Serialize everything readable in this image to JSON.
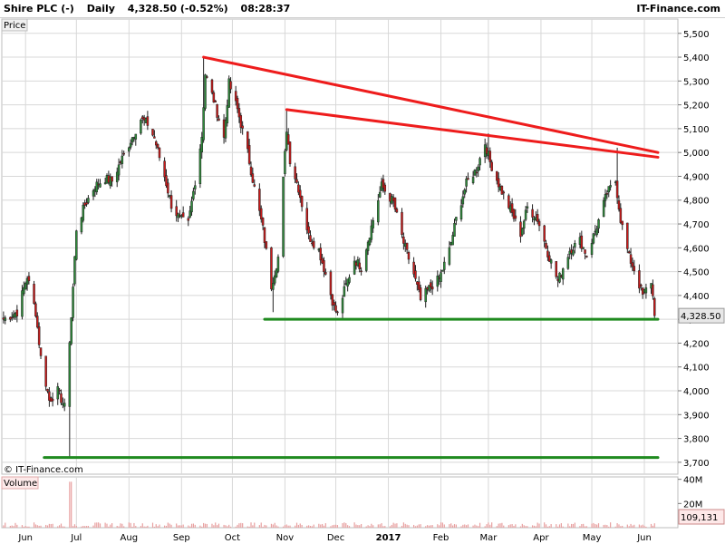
{
  "header": {
    "instrument": "Shire PLC (-)",
    "interval": "Daily",
    "quote": "4,328.50 (-0.52%)",
    "time": "08:28:37",
    "brand": "IT-Finance.com"
  },
  "colors": {
    "up": "#2e8b3a",
    "down": "#cc1a1a",
    "resistance": "#ee1c1c",
    "support": "#1f8a1f",
    "grid": "#d8d8d8",
    "volume": "#e8a0a0",
    "last_box": "#e7e7e7"
  },
  "chart_data": [
    {
      "type": "candlestick",
      "panel_label": "Price",
      "watermark": "© IT-Finance.com",
      "last_price_label": "4,328.50",
      "y_ticks": [
        3700,
        3800,
        3900,
        4000,
        4100,
        4200,
        4300,
        4400,
        4500,
        4600,
        4700,
        4800,
        4900,
        5000,
        5100,
        5200,
        5300,
        5400,
        5500
      ],
      "y_tick_labels": [
        "3,700",
        "3,800",
        "3,900",
        "4,000",
        "4,100",
        "4,200",
        "4,300",
        "4,400",
        "4,500",
        "4,600",
        "4,700",
        "4,800",
        "4,900",
        "5,000",
        "5,100",
        "5,200",
        "5,300",
        "5,400",
        "5,500"
      ],
      "x_labels": [
        {
          "date": "2016-06-01",
          "text": "Jun",
          "bold": false
        },
        {
          "date": "2016-07-01",
          "text": "Jul",
          "bold": false
        },
        {
          "date": "2016-08-01",
          "text": "Aug",
          "bold": false
        },
        {
          "date": "2016-09-01",
          "text": "Sep",
          "bold": false
        },
        {
          "date": "2016-10-01",
          "text": "Oct",
          "bold": false
        },
        {
          "date": "2016-11-01",
          "text": "Nov",
          "bold": false
        },
        {
          "date": "2016-12-01",
          "text": "Dec",
          "bold": false
        },
        {
          "date": "2017-01-01",
          "text": "2017",
          "bold": true
        },
        {
          "date": "2017-02-01",
          "text": "Feb",
          "bold": false
        },
        {
          "date": "2017-03-01",
          "text": "Mar",
          "bold": false
        },
        {
          "date": "2017-04-01",
          "text": "Apr",
          "bold": false
        },
        {
          "date": "2017-05-01",
          "text": "May",
          "bold": false
        },
        {
          "date": "2017-06-01",
          "text": "Jun",
          "bold": false
        }
      ],
      "close_path": [
        [
          "2016-05-19",
          4300
        ],
        [
          "2016-05-27",
          4330
        ],
        [
          "2016-06-02",
          4480
        ],
        [
          "2016-06-07",
          4330
        ],
        [
          "2016-06-10",
          4140
        ],
        [
          "2016-06-15",
          3960
        ],
        [
          "2016-06-20",
          4000
        ],
        [
          "2016-06-24",
          3930
        ],
        [
          "2016-06-28",
          4310
        ],
        [
          "2016-07-01",
          4680
        ],
        [
          "2016-07-06",
          4780
        ],
        [
          "2016-07-12",
          4860
        ],
        [
          "2016-07-18",
          4890
        ],
        [
          "2016-07-22",
          4880
        ],
        [
          "2016-07-27",
          4960
        ],
        [
          "2016-08-02",
          5050
        ],
        [
          "2016-08-08",
          5140
        ],
        [
          "2016-08-12",
          5120
        ],
        [
          "2016-08-16",
          5060
        ],
        [
          "2016-08-22",
          4900
        ],
        [
          "2016-08-26",
          4780
        ],
        [
          "2016-08-31",
          4720
        ],
        [
          "2016-09-05",
          4700
        ],
        [
          "2016-09-09",
          4880
        ],
        [
          "2016-09-13",
          5070
        ],
        [
          "2016-09-15",
          5330
        ],
        [
          "2016-09-20",
          5220
        ],
        [
          "2016-09-26",
          5060
        ],
        [
          "2016-09-29",
          5290
        ],
        [
          "2016-10-04",
          5180
        ],
        [
          "2016-10-10",
          5000
        ],
        [
          "2016-10-14",
          4850
        ],
        [
          "2016-10-19",
          4680
        ],
        [
          "2016-10-24",
          4440
        ],
        [
          "2016-10-28",
          4560
        ],
        [
          "2016-11-02",
          5100
        ],
        [
          "2016-11-04",
          4970
        ],
        [
          "2016-11-09",
          4850
        ],
        [
          "2016-11-15",
          4650
        ],
        [
          "2016-11-21",
          4590
        ],
        [
          "2016-11-25",
          4490
        ],
        [
          "2016-11-30",
          4350
        ],
        [
          "2016-12-02",
          4320
        ],
        [
          "2016-12-06",
          4420
        ],
        [
          "2016-12-12",
          4550
        ],
        [
          "2016-12-16",
          4520
        ],
        [
          "2016-12-21",
          4660
        ],
        [
          "2016-12-28",
          4860
        ],
        [
          "2017-01-04",
          4790
        ],
        [
          "2017-01-10",
          4620
        ],
        [
          "2017-01-16",
          4490
        ],
        [
          "2017-01-20",
          4380
        ],
        [
          "2017-01-25",
          4430
        ],
        [
          "2017-01-31",
          4470
        ],
        [
          "2017-02-06",
          4590
        ],
        [
          "2017-02-10",
          4720
        ],
        [
          "2017-02-16",
          4870
        ],
        [
          "2017-02-22",
          4930
        ],
        [
          "2017-02-27",
          5040
        ],
        [
          "2017-03-02",
          4960
        ],
        [
          "2017-03-08",
          4850
        ],
        [
          "2017-03-14",
          4760
        ],
        [
          "2017-03-20",
          4660
        ],
        [
          "2017-03-24",
          4770
        ],
        [
          "2017-03-30",
          4720
        ],
        [
          "2017-04-05",
          4580
        ],
        [
          "2017-04-11",
          4460
        ],
        [
          "2017-04-18",
          4590
        ],
        [
          "2017-04-24",
          4630
        ],
        [
          "2017-04-28",
          4570
        ],
        [
          "2017-05-04",
          4690
        ],
        [
          "2017-05-10",
          4830
        ],
        [
          "2017-05-15",
          4880
        ],
        [
          "2017-05-18",
          4720
        ],
        [
          "2017-05-23",
          4560
        ],
        [
          "2017-05-26",
          4510
        ],
        [
          "2017-05-31",
          4400
        ],
        [
          "2017-06-05",
          4460
        ],
        [
          "2017-06-07",
          4330
        ]
      ],
      "spikes": [
        {
          "date": "2016-06-27",
          "low": 3720
        },
        {
          "date": "2016-09-14",
          "high": 5400
        },
        {
          "date": "2016-10-25",
          "low": 4330
        },
        {
          "date": "2016-11-02",
          "high": 5180
        },
        {
          "date": "2017-03-01",
          "high": 5080
        },
        {
          "date": "2017-05-16",
          "high": 5020
        }
      ],
      "trendlines": [
        {
          "role": "resistance",
          "from": [
            "2016-09-14",
            5400
          ],
          "to": [
            "2017-06-09",
            5000
          ]
        },
        {
          "role": "resistance",
          "from": [
            "2016-11-02",
            5180
          ],
          "to": [
            "2017-06-09",
            4980
          ]
        },
        {
          "role": "support",
          "from": [
            "2016-10-20",
            4300
          ],
          "to": [
            "2017-06-09",
            4300
          ]
        },
        {
          "role": "support",
          "from": [
            "2016-06-12",
            3720
          ],
          "to": [
            "2017-06-09",
            3720
          ]
        }
      ]
    },
    {
      "type": "bar",
      "panel_label": "Volume",
      "last_value_label": "109,131",
      "y_ticks": [
        20000000,
        40000000
      ],
      "y_tick_labels": [
        "20M",
        "40M"
      ],
      "spikes": [
        {
          "date": "2016-06-27",
          "value": 38000000
        }
      ]
    }
  ]
}
